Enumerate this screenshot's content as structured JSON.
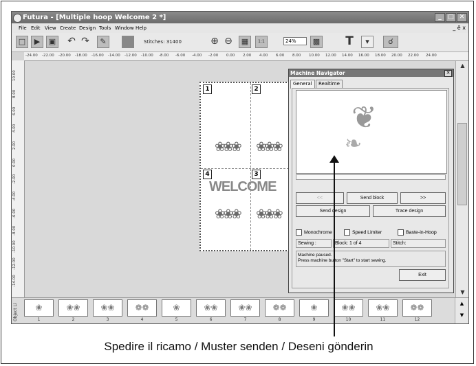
{
  "window": {
    "title": "Futura - [Multiple hoop Welcome 2 *]"
  },
  "menu": [
    "File",
    "Edit",
    "View",
    "Create",
    "Design",
    "Tools",
    "Window",
    "Help"
  ],
  "menu_mdi": "_ ē x",
  "toolbar": {
    "stitches": "Stitches: 31400",
    "zoom": "24%"
  },
  "ruler_h": [
    "-24.00",
    "-22.00",
    "-20.00",
    "-18.00",
    "-16.00",
    "-14.00",
    "-12.00",
    "-10.00",
    "-8.00",
    "-6.00",
    "-4.00",
    "-2.00",
    "0.00",
    "2.00",
    "4.00",
    "6.00",
    "8.00",
    "10.00",
    "12.00",
    "14.00",
    "16.00",
    "18.00",
    "20.00",
    "22.00",
    "24.00"
  ],
  "ruler_v": [
    "10.00",
    "8.00",
    "6.00",
    "4.00",
    "2.00",
    "0.00",
    "-2.00",
    "-4.00",
    "-6.00",
    "-8.00",
    "-10.00",
    "-12.00",
    "-14.00"
  ],
  "hoop": {
    "badges": [
      "1",
      "2",
      "4",
      "3"
    ],
    "text": "WELCOME"
  },
  "object_bar": {
    "label": "Object Li",
    "items": [
      "1",
      "2",
      "3",
      "4",
      "5",
      "6",
      "7",
      "8",
      "9",
      "10",
      "11",
      "12"
    ]
  },
  "dialog": {
    "title": "Machine Navigator",
    "tabs": [
      "General",
      "Realtime"
    ],
    "prev_label": "<<",
    "send_block_label": "Send block",
    "next_label": ">>",
    "send_design_label": "Send design",
    "trace_design_label": "Trace design",
    "monochrome_label": "Monochrome",
    "speed_limiter_label": "Speed Limiter",
    "baste_label": "Baste-in-Hoop",
    "sewing_label": "Sewing :",
    "block_label": "Block: 1 of 4",
    "stitch_label": "Stitch:",
    "message_line1": "Machine paused.",
    "message_line2": "Press machine button \"Start\" to start sewing.",
    "exit_label": "Exit"
  },
  "caption": "Spedire il ricamo / Muster senden / Deseni gönderin"
}
